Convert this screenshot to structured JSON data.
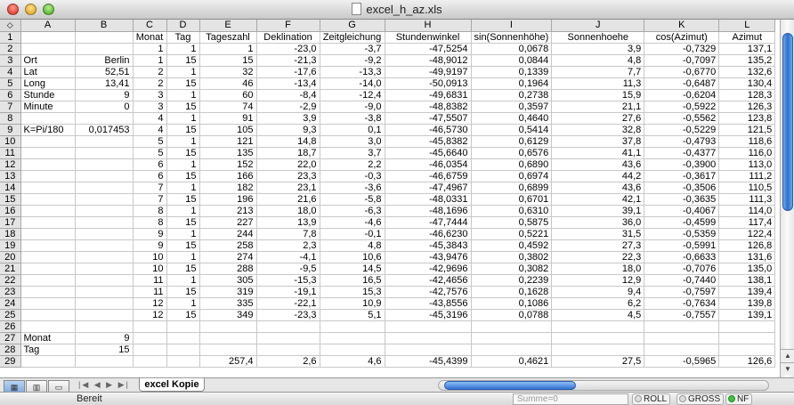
{
  "window": {
    "title": "excel_h_az.xls"
  },
  "columns": [
    "A",
    "B",
    "C",
    "D",
    "E",
    "F",
    "G",
    "H",
    "I",
    "J",
    "K",
    "L"
  ],
  "rows": [
    {
      "n": "1",
      "cells": [
        "",
        "",
        "Monat",
        "Tag",
        "Tageszahl",
        "Deklination",
        "Zeitgleichung",
        "Stundenwinkel",
        "sin(Sonnenhöhe)",
        "Sonnenhoehe",
        "cos(Azimut)",
        "Azimut"
      ]
    },
    {
      "n": "2",
      "cells": [
        "",
        "",
        "1",
        "1",
        "1",
        "-23,0",
        "-3,7",
        "-47,5254",
        "0,0678",
        "3,9",
        "-0,7329",
        "137,1"
      ]
    },
    {
      "n": "3",
      "cells": [
        "Ort",
        "Berlin",
        "1",
        "15",
        "15",
        "-21,3",
        "-9,2",
        "-48,9012",
        "0,0844",
        "4,8",
        "-0,7097",
        "135,2"
      ]
    },
    {
      "n": "4",
      "cells": [
        "Lat",
        "52,51",
        "2",
        "1",
        "32",
        "-17,6",
        "-13,3",
        "-49,9197",
        "0,1339",
        "7,7",
        "-0,6770",
        "132,6"
      ]
    },
    {
      "n": "5",
      "cells": [
        "Long",
        "13,41",
        "2",
        "15",
        "46",
        "-13,4",
        "-14,0",
        "-50,0913",
        "0,1964",
        "11,3",
        "-0,6487",
        "130,4"
      ]
    },
    {
      "n": "6",
      "cells": [
        "Stunde",
        "9",
        "3",
        "1",
        "60",
        "-8,4",
        "-12,4",
        "-49,6831",
        "0,2738",
        "15,9",
        "-0,6204",
        "128,3"
      ]
    },
    {
      "n": "7",
      "cells": [
        "Minute",
        "0",
        "3",
        "15",
        "74",
        "-2,9",
        "-9,0",
        "-48,8382",
        "0,3597",
        "21,1",
        "-0,5922",
        "126,3"
      ]
    },
    {
      "n": "8",
      "cells": [
        "",
        "",
        "4",
        "1",
        "91",
        "3,9",
        "-3,8",
        "-47,5507",
        "0,4640",
        "27,6",
        "-0,5562",
        "123,8"
      ]
    },
    {
      "n": "9",
      "cells": [
        "K=Pi/180",
        "0,017453",
        "4",
        "15",
        "105",
        "9,3",
        "0,1",
        "-46,5730",
        "0,5414",
        "32,8",
        "-0,5229",
        "121,5"
      ]
    },
    {
      "n": "10",
      "cells": [
        "",
        "",
        "5",
        "1",
        "121",
        "14,8",
        "3,0",
        "-45,8382",
        "0,6129",
        "37,8",
        "-0,4793",
        "118,6"
      ]
    },
    {
      "n": "11",
      "cells": [
        "",
        "",
        "5",
        "15",
        "135",
        "18,7",
        "3,7",
        "-45,6640",
        "0,6576",
        "41,1",
        "-0,4377",
        "116,0"
      ]
    },
    {
      "n": "12",
      "cells": [
        "",
        "",
        "6",
        "1",
        "152",
        "22,0",
        "2,2",
        "-46,0354",
        "0,6890",
        "43,6",
        "-0,3900",
        "113,0"
      ]
    },
    {
      "n": "13",
      "cells": [
        "",
        "",
        "6",
        "15",
        "166",
        "23,3",
        "-0,3",
        "-46,6759",
        "0,6974",
        "44,2",
        "-0,3617",
        "111,2"
      ]
    },
    {
      "n": "14",
      "cells": [
        "",
        "",
        "7",
        "1",
        "182",
        "23,1",
        "-3,6",
        "-47,4967",
        "0,6899",
        "43,6",
        "-0,3506",
        "110,5"
      ]
    },
    {
      "n": "15",
      "cells": [
        "",
        "",
        "7",
        "15",
        "196",
        "21,6",
        "-5,8",
        "-48,0331",
        "0,6701",
        "42,1",
        "-0,3635",
        "111,3"
      ]
    },
    {
      "n": "16",
      "cells": [
        "",
        "",
        "8",
        "1",
        "213",
        "18,0",
        "-6,3",
        "-48,1696",
        "0,6310",
        "39,1",
        "-0,4067",
        "114,0"
      ]
    },
    {
      "n": "17",
      "cells": [
        "",
        "",
        "8",
        "15",
        "227",
        "13,9",
        "-4,6",
        "-47,7444",
        "0,5875",
        "36,0",
        "-0,4599",
        "117,4"
      ]
    },
    {
      "n": "18",
      "cells": [
        "",
        "",
        "9",
        "1",
        "244",
        "7,8",
        "-0,1",
        "-46,6230",
        "0,5221",
        "31,5",
        "-0,5359",
        "122,4"
      ]
    },
    {
      "n": "19",
      "cells": [
        "",
        "",
        "9",
        "15",
        "258",
        "2,3",
        "4,8",
        "-45,3843",
        "0,4592",
        "27,3",
        "-0,5991",
        "126,8"
      ]
    },
    {
      "n": "20",
      "cells": [
        "",
        "",
        "10",
        "1",
        "274",
        "-4,1",
        "10,6",
        "-43,9476",
        "0,3802",
        "22,3",
        "-0,6633",
        "131,6"
      ]
    },
    {
      "n": "21",
      "cells": [
        "",
        "",
        "10",
        "15",
        "288",
        "-9,5",
        "14,5",
        "-42,9696",
        "0,3082",
        "18,0",
        "-0,7076",
        "135,0"
      ]
    },
    {
      "n": "22",
      "cells": [
        "",
        "",
        "11",
        "1",
        "305",
        "-15,3",
        "16,5",
        "-42,4656",
        "0,2239",
        "12,9",
        "-0,7440",
        "138,1"
      ]
    },
    {
      "n": "23",
      "cells": [
        "",
        "",
        "11",
        "15",
        "319",
        "-19,1",
        "15,3",
        "-42,7576",
        "0,1628",
        "9,4",
        "-0,7597",
        "139,4"
      ]
    },
    {
      "n": "24",
      "cells": [
        "",
        "",
        "12",
        "1",
        "335",
        "-22,1",
        "10,9",
        "-43,8556",
        "0,1086",
        "6,2",
        "-0,7634",
        "139,8"
      ]
    },
    {
      "n": "25",
      "cells": [
        "",
        "",
        "12",
        "15",
        "349",
        "-23,3",
        "5,1",
        "-45,3196",
        "0,0788",
        "4,5",
        "-0,7557",
        "139,1"
      ]
    },
    {
      "n": "26",
      "cells": [
        "",
        "",
        "",
        "",
        "",
        "",
        "",
        "",
        "",
        "",
        "",
        ""
      ]
    },
    {
      "n": "27",
      "cells": [
        "Monat",
        "9",
        "",
        "",
        "",
        "",
        "",
        "",
        "",
        "",
        "",
        ""
      ]
    },
    {
      "n": "28",
      "cells": [
        "Tag",
        "15",
        "",
        "",
        "",
        "",
        "",
        "",
        "",
        "",
        "",
        ""
      ]
    },
    {
      "n": "29",
      "cells": [
        "",
        "",
        "",
        "",
        "257,4",
        "2,6",
        "4,6",
        "-45,4399",
        "0,4621",
        "27,5",
        "-0,5965",
        "126,6"
      ]
    }
  ],
  "sheet_tabs": [
    {
      "label": "excel Kopie"
    }
  ],
  "tab_nav": "|◀ ◀ ▶ ▶|",
  "status": {
    "ready": "Bereit",
    "sum": "Summe=0",
    "roll": "ROLL",
    "caps": "GROSS",
    "num": "NF"
  },
  "icons": {
    "close": "close-icon",
    "minimize": "minimize-icon",
    "zoom": "zoom-icon",
    "document": "xls-document-icon",
    "corner": "select-all-icon"
  },
  "colors": {
    "scroll_thumb": "#2d6fd0",
    "num_indicator": "#3cc23c"
  }
}
